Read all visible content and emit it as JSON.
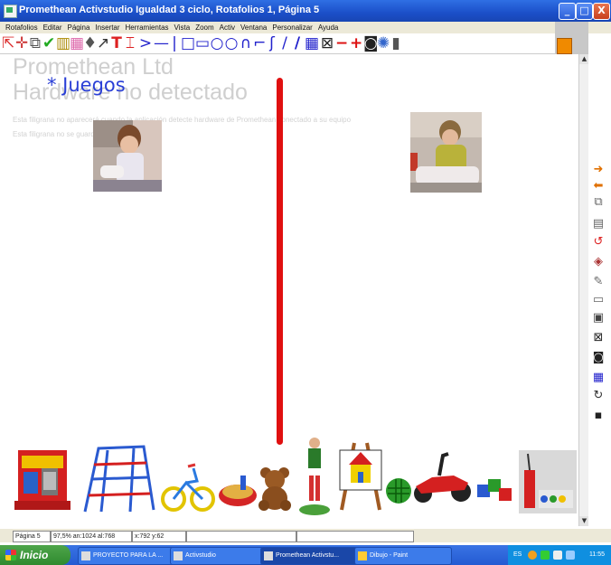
{
  "window": {
    "title": "Promethean Activstudio  Igualdad 3 ciclo,  Rotafolios 1,  Página 5",
    "min_label": "_",
    "max_label": "□",
    "close_label": "X"
  },
  "menu": [
    "Rotafolios",
    "Editar",
    "Página",
    "Insertar",
    "Herramientas",
    "Vista",
    "Zoom",
    "Activ",
    "Ventana",
    "Personalizar",
    "Ayuda"
  ],
  "toolbar_icons": [
    "select-arrow-icon",
    "pointer-hand-icon",
    "clone-icon",
    "pen-icon",
    "stamp-icon",
    "highlighter-icon",
    "fill-icon",
    "marker-icon",
    "text-icon",
    "text-box-icon",
    "arrow-line-icon",
    "line-icon",
    "vertical-line-icon",
    "rectangle-icon",
    "rectangle-outline-icon",
    "circle-icon",
    "ellipse-icon",
    "arc-icon",
    "curve-icon",
    "freehand-icon",
    "diagonal-line-icon",
    "thick-line-icon",
    "grid-icon",
    "link-icon",
    "minus-icon",
    "plus-icon",
    "camera-icon",
    "palette-icon",
    "trash-icon"
  ],
  "watermark": {
    "company": "Promethean Ltd",
    "hardware": "Hardware no detectado",
    "line1": "Esta filigrana no aparecerá cuando la aplicación detecte hardware de Promethean conectado a su equipo",
    "line2": "Esta filigrana no se guardará con el rotafolios"
  },
  "page_heading": "* Juegos",
  "right_tools": [
    "arrow-right-icon",
    "arrow-left-icon",
    "copy-page-icon",
    "page-sorter-icon",
    "undo-red-icon",
    "palette-stack-icon",
    "pin-icon",
    "dual-page-icon",
    "page-number-icon",
    "hand-link-icon",
    "camera-icon",
    "grid-icon",
    "redo-icon",
    "save-icon"
  ],
  "statusbar": {
    "page": "Página 5",
    "zoom": "97,5%  an:1024  al:768",
    "coords": "x:792  y:62"
  },
  "taskbar": {
    "start_label": "Inicio",
    "buttons": [
      "PROYECTO PARA LA ...",
      "Activstudio",
      "Promethean Activstu...",
      "Dibujo - Paint"
    ],
    "tray_lang": "ES",
    "clock": "11:55"
  },
  "colors": {
    "title_blue": "#1b4fc8",
    "red_line": "#e01010",
    "heading_blue": "#2a3fd6",
    "taskbar_blue": "#245ad2",
    "start_green": "#2f8a2f"
  }
}
